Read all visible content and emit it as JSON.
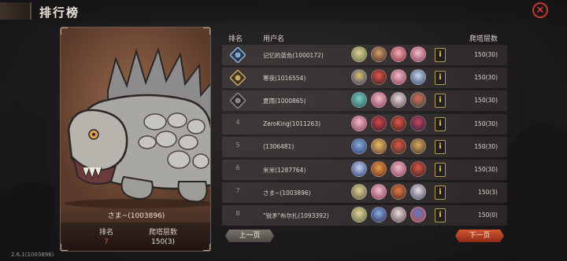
{
  "header": {
    "title": "排行榜"
  },
  "card": {
    "player_name": "さま~(1003896)",
    "rank_label": "排名",
    "rank_value": "7",
    "floor_label": "爬塔层数",
    "floor_value": "150(3)"
  },
  "table": {
    "col_rank": "排名",
    "col_user": "用户名",
    "col_floor": "爬塔层数",
    "rows": [
      {
        "rank": "1",
        "name": "记忆的蓝色(1000172)",
        "floor": "150(30)"
      },
      {
        "rank": "2",
        "name": "寒夜(1016554)",
        "floor": "150(30)"
      },
      {
        "rank": "3",
        "name": "夏雨(1000865)",
        "floor": "150(30)"
      },
      {
        "rank": "4",
        "name": "ZeroKing(1011263)",
        "floor": "150(30)"
      },
      {
        "rank": "5",
        "name": "(1306481)",
        "floor": "150(30)"
      },
      {
        "rank": "6",
        "name": "米米(1287764)",
        "floor": "150(30)"
      },
      {
        "rank": "7",
        "name": "さま~(1003896)",
        "floor": "150(3)"
      },
      {
        "rank": "8",
        "name": "\"锐矛\"布尔扎(1093392)",
        "floor": "150(0)"
      }
    ]
  },
  "pager": {
    "prev": "上一页",
    "next": "下一页"
  },
  "version": "2.6.1(1003896)",
  "icons": {
    "close": "close-icon",
    "info": "info-icon"
  },
  "colors": {
    "accent_red": "#c0392b",
    "next_button": "#c8502a"
  }
}
